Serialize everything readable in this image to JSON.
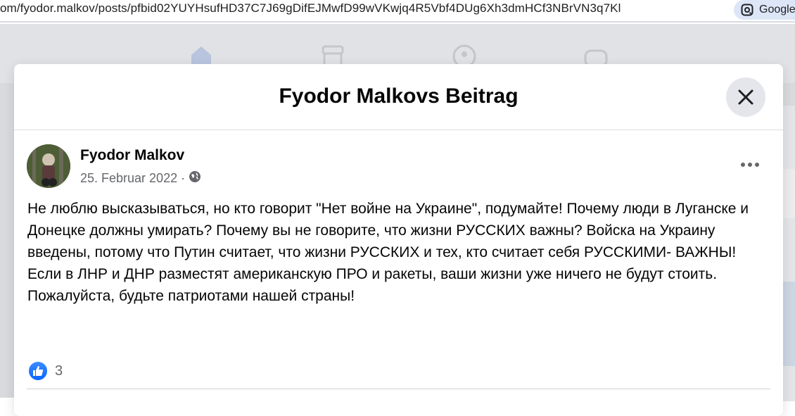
{
  "browser": {
    "url": "om/fyodor.malkov/posts/pfbid02YUYHsufHD37C7J69gDifEJMwfD99wVKwjq4R5Vbf4DUg6Xh3dmHCf3NBrVN3q7Kl",
    "google_chip_label": "Google"
  },
  "modal": {
    "title": "Fyodor Malkovs Beitrag"
  },
  "post": {
    "author": "Fyodor Malkov",
    "date": "25. Februar 2022",
    "separator": "·",
    "privacy_icon": "globe-icon",
    "text_lines": [
      "Не люблю высказываться, но кто говорит \"Нет войне на Украине\", подумайте! Почему люди в Луганске и Донецке должны умирать? Почему вы не говорите, что жизни РУССКИХ важны? Войска на Украину введены, потому что Путин считает, что жизни РУССКИХ и тех, кто считает себя РУССКИМИ- ВАЖНЫ!",
      "Если в ЛНР и ДНР разместят американскую ПРО и ракеты, ваши жизни уже ничего не будут стоить.",
      "Пожалуйста, будьте патриотами нашей страны!"
    ],
    "reaction_icon": "like-icon",
    "reaction_count": "3"
  },
  "colors": {
    "like_blue": "#0866ff",
    "secondary_text": "#65676b",
    "primary_text": "#050505"
  }
}
